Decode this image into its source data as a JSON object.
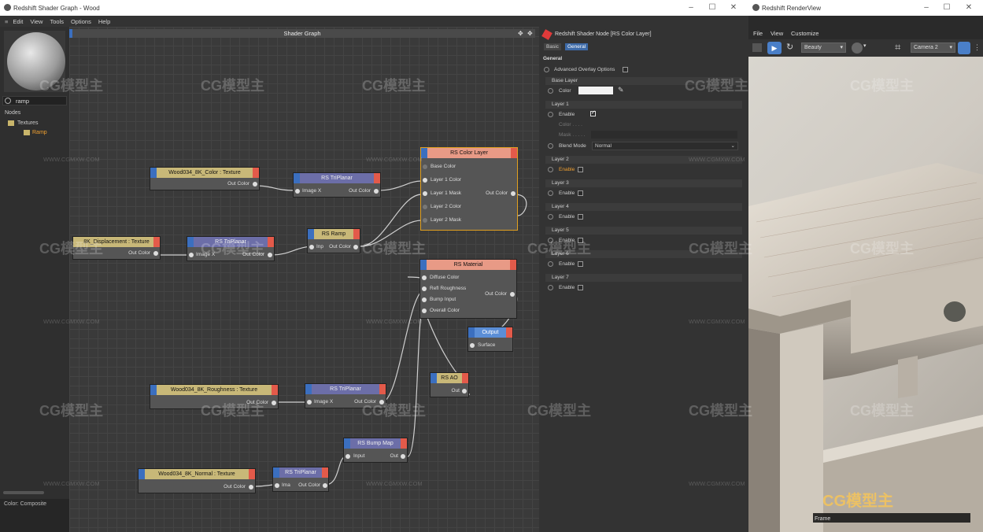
{
  "shader_window": {
    "title": "Redshift Shader Graph - Wood",
    "menu": [
      "Edit",
      "View",
      "Tools",
      "Options",
      "Help"
    ],
    "search_value": "ramp",
    "nodes_label": "Nodes",
    "tree": {
      "textures": "Textures",
      "ramp": "Ramp"
    },
    "bottom_label": "Color: Composite",
    "graph_title": "Shader Graph"
  },
  "nodes": {
    "color_texture": {
      "title": "Wood034_8K_Color : Texture",
      "out": "Out Color"
    },
    "displacement_texture": {
      "title": "8K_Displacement : Texture",
      "out": "Out Color"
    },
    "roughness_texture": {
      "title": "Wood034_8K_Roughness : Texture",
      "out": "Out Color"
    },
    "normal_texture": {
      "title": "Wood034_8K_Normal : Texture",
      "out": "Out Color"
    },
    "triplanar1": {
      "title": "RS TriPlanar",
      "in": "Image X",
      "out": "Out Color"
    },
    "triplanar2": {
      "title": "RS TriPlanar",
      "in": "Image X",
      "out": "Out Color"
    },
    "triplanar3": {
      "title": "RS TriPlanar",
      "in": "Image X",
      "out": "Out Color"
    },
    "triplanar4": {
      "title": "RS TriPlanar",
      "in": "Ima",
      "out": "Out Color"
    },
    "ramp": {
      "title": "RS Ramp",
      "in": "Inp",
      "out": "Out Color"
    },
    "color_layer": {
      "title": "RS Color Layer",
      "ports": [
        "Base Color",
        "Layer 1 Color",
        "Layer 1 Mask",
        "Layer 2 Color",
        "Layer 2 Mask"
      ],
      "out": "Out Color"
    },
    "material": {
      "title": "RS Material",
      "ports": [
        "Diffuse Color",
        "Refl Roughness",
        "Bump Input",
        "Overall Color"
      ],
      "out": "Out Color"
    },
    "output": {
      "title": "Output",
      "in": "Surface"
    },
    "ao": {
      "title": "RS AO",
      "out": "Out"
    },
    "bump": {
      "title": "RS Bump Map",
      "in": "Input",
      "out": "Out"
    }
  },
  "props": {
    "header": "Redshift Shader Node [RS Color Layer]",
    "tabs": [
      "Basic",
      "General"
    ],
    "section": "General",
    "advanced": "Advanced Overlay Options",
    "base_layer": "Base Layer",
    "color": "Color",
    "layer1": "Layer 1",
    "enable": "Enable",
    "color_dim": "Color . . . .",
    "mask": "Mask . . . . .",
    "blend_mode": "Blend Mode",
    "blend_value": "Normal",
    "layers": [
      "Layer 2",
      "Layer 3",
      "Layer 4",
      "Layer 5",
      "Layer 6",
      "Layer 7"
    ]
  },
  "render": {
    "title": "Redshift RenderView",
    "menu": [
      "File",
      "View",
      "Customize"
    ],
    "aov": "Beauty",
    "camera": "Camera 2",
    "frame": "Frame"
  },
  "watermark": {
    "logo": "CG模型主",
    "url": "WWW.CGMXW.COM"
  }
}
